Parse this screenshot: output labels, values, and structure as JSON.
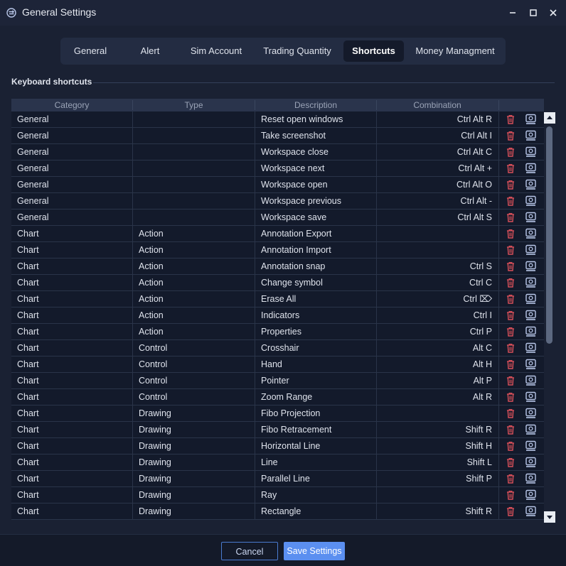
{
  "window": {
    "title": "General Settings"
  },
  "tabs": [
    {
      "label": "General",
      "active": false
    },
    {
      "label": "Alert",
      "active": false
    },
    {
      "label": "Sim Account",
      "active": false
    },
    {
      "label": "Trading Quantity",
      "active": false
    },
    {
      "label": "Shortcuts",
      "active": true
    },
    {
      "label": "Money Managment",
      "active": false
    }
  ],
  "section": {
    "title": "Keyboard shortcuts"
  },
  "table": {
    "columns": [
      "Category",
      "Type",
      "Description",
      "Combination"
    ],
    "rows": [
      {
        "category": "General",
        "type": "",
        "description": "Reset open windows",
        "combination": "Ctrl Alt R"
      },
      {
        "category": "General",
        "type": "",
        "description": "Take screenshot",
        "combination": "Ctrl Alt I"
      },
      {
        "category": "General",
        "type": "",
        "description": "Workspace close",
        "combination": "Ctrl Alt C"
      },
      {
        "category": "General",
        "type": "",
        "description": "Workspace next",
        "combination": "Ctrl Alt +"
      },
      {
        "category": "General",
        "type": "",
        "description": "Workspace open",
        "combination": "Ctrl Alt O"
      },
      {
        "category": "General",
        "type": "",
        "description": "Workspace previous",
        "combination": "Ctrl Alt -"
      },
      {
        "category": "General",
        "type": "",
        "description": "Workspace save",
        "combination": "Ctrl Alt S"
      },
      {
        "category": "Chart",
        "type": "Action",
        "description": "Annotation Export",
        "combination": ""
      },
      {
        "category": "Chart",
        "type": "Action",
        "description": "Annotation Import",
        "combination": ""
      },
      {
        "category": "Chart",
        "type": "Action",
        "description": "Annotation snap",
        "combination": "Ctrl S"
      },
      {
        "category": "Chart",
        "type": "Action",
        "description": "Change symbol",
        "combination": "Ctrl C"
      },
      {
        "category": "Chart",
        "type": "Action",
        "description": "Erase All",
        "combination": "Ctrl ⌦"
      },
      {
        "category": "Chart",
        "type": "Action",
        "description": "Indicators",
        "combination": "Ctrl I"
      },
      {
        "category": "Chart",
        "type": "Action",
        "description": "Properties",
        "combination": "Ctrl P"
      },
      {
        "category": "Chart",
        "type": "Control",
        "description": "Crosshair",
        "combination": "Alt C"
      },
      {
        "category": "Chart",
        "type": "Control",
        "description": "Hand",
        "combination": "Alt H"
      },
      {
        "category": "Chart",
        "type": "Control",
        "description": "Pointer",
        "combination": "Alt P"
      },
      {
        "category": "Chart",
        "type": "Control",
        "description": "Zoom Range",
        "combination": "Alt R"
      },
      {
        "category": "Chart",
        "type": "Drawing",
        "description": "Fibo Projection",
        "combination": ""
      },
      {
        "category": "Chart",
        "type": "Drawing",
        "description": "Fibo Retracement",
        "combination": "Shift R"
      },
      {
        "category": "Chart",
        "type": "Drawing",
        "description": "Horizontal Line",
        "combination": "Shift H"
      },
      {
        "category": "Chart",
        "type": "Drawing",
        "description": "Line",
        "combination": "Shift L"
      },
      {
        "category": "Chart",
        "type": "Drawing",
        "description": "Parallel Line",
        "combination": "Shift P"
      },
      {
        "category": "Chart",
        "type": "Drawing",
        "description": "Ray",
        "combination": ""
      },
      {
        "category": "Chart",
        "type": "Drawing",
        "description": "Rectangle",
        "combination": "Shift R"
      }
    ]
  },
  "footer": {
    "cancel_label": "Cancel",
    "save_label": "Save Settings"
  },
  "colors": {
    "accent": "#5b8ff0",
    "delete_icon": "#d9505a",
    "record_icon": "#b8c6e8",
    "background": "#1a2133"
  },
  "icons": {
    "app": "sync-icon",
    "delete": "trash-icon",
    "record": "keyboard-record-icon"
  }
}
